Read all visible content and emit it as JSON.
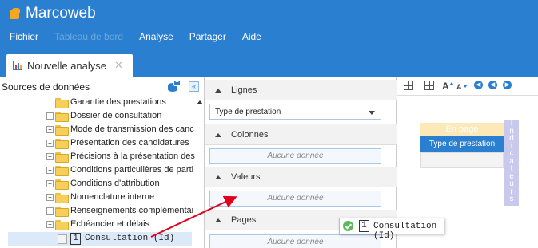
{
  "app": {
    "name": "Marcoweb"
  },
  "menu": [
    {
      "label": "Fichier",
      "disabled": false
    },
    {
      "label": "Tableau de bord",
      "disabled": true
    },
    {
      "label": "Analyse",
      "disabled": false
    },
    {
      "label": "Partager",
      "disabled": false
    },
    {
      "label": "Aide",
      "disabled": false
    }
  ],
  "tab": {
    "label": "Nouvelle analyse",
    "close": "✕"
  },
  "left_panel": {
    "title": "Sources de données",
    "collapse": "«",
    "tree": [
      {
        "label": "Garantie des prestations",
        "expandable": false
      },
      {
        "label": "Dossier de consultation",
        "expandable": true
      },
      {
        "label": "Mode de transmission des canc",
        "expandable": true
      },
      {
        "label": "Présentation des candidatures",
        "expandable": true
      },
      {
        "label": "Précisions à la présentation des",
        "expandable": true
      },
      {
        "label": "Conditions particulières de parti",
        "expandable": true
      },
      {
        "label": "Conditions d'attribution",
        "expandable": true
      },
      {
        "label": "Nomenclature interne",
        "expandable": true
      },
      {
        "label": "Renseignements complémentai",
        "expandable": true
      },
      {
        "label": "Echéancier et délais",
        "expandable": true
      }
    ],
    "selected_measure": {
      "type": "1",
      "label": "Consultation (Id)"
    }
  },
  "pivot": {
    "rows": {
      "title": "Lignes",
      "value": "Type de prestation"
    },
    "columns": {
      "title": "Colonnes",
      "empty": "Aucune donnée"
    },
    "values": {
      "title": "Valeurs",
      "empty": "Aucune donnée"
    },
    "pages": {
      "title": "Pages",
      "empty": "Aucune donnée"
    }
  },
  "preview": {
    "en_page": "En page",
    "row_header": "Type de prestation",
    "indicators": [
      "I",
      "n",
      "d",
      "i",
      "c",
      "a",
      "t",
      "e",
      "u",
      "r",
      "s"
    ]
  },
  "drag_tooltip": {
    "type": "1",
    "label": "Consultation (Id)"
  },
  "colors": {
    "brand": "#2b7fd0",
    "folder": "#f5cf5a",
    "ok": "#5cb85c",
    "arrow": "#e3001b"
  }
}
